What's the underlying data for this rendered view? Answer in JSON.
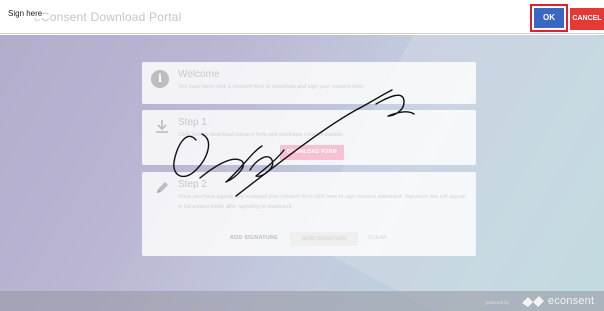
{
  "header": {
    "app_title": "eConsent Download Portal",
    "sign_here_label": "Sign here",
    "ok_label": "OK",
    "cancel_label": "CANCEL"
  },
  "cards": {
    "welcome": {
      "icon": "info-icon",
      "icon_glyph": "i",
      "title": "Welcome",
      "text": "You have been sent a consent form to download and sign your consent form."
    },
    "step1": {
      "icon": "download-icon",
      "title": "Step 1",
      "text": "Click here to download consent form and print/view consent leaflets.",
      "button_label": "DOWNLOAD FORM"
    },
    "step2": {
      "icon": "pencil-icon",
      "title": "Step 2",
      "text": "Once you have signed and reviewed your consent form click here to sign consent statement. Signature box will appear in full screen mode after agreeing to statement.",
      "add_signature_label": "ADD SIGNATURE",
      "send_signature_label": "SEND SIGNATURE",
      "clear_label": "CLEAR"
    }
  },
  "footer": {
    "powered_by": "powered by",
    "brand": "econsent"
  },
  "colors": {
    "ok_button": "#3a66c4",
    "cancel_button": "#e53935",
    "highlight_border": "#e0202c",
    "download_button": "#f8c1d3",
    "signature_ink": "#111111"
  }
}
